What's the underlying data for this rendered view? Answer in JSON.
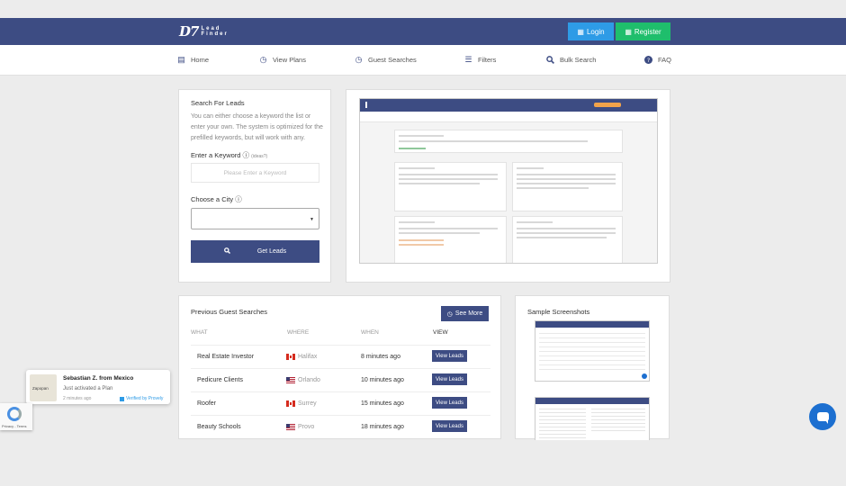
{
  "brand": {
    "mark": "D7",
    "line1": "Lead",
    "line2": "Finder"
  },
  "header": {
    "login_label": "Login",
    "register_label": "Register"
  },
  "nav": [
    {
      "label": "Home",
      "icon": "bank-icon"
    },
    {
      "label": "View Plans",
      "icon": "history-icon"
    },
    {
      "label": "Guest Searches",
      "icon": "history-icon"
    },
    {
      "label": "Filters",
      "icon": "database-icon"
    },
    {
      "label": "Bulk Search",
      "icon": "search-icon"
    },
    {
      "label": "FAQ",
      "icon": "question-icon"
    }
  ],
  "search": {
    "title": "Search For Leads",
    "description": "You can either choose a keyword the list or enter your own. The system is optimized for the prefilled keywords, but will work with any.",
    "keyword_label": "Enter a Keyword",
    "keyword_hint": "(ideas?)",
    "keyword_placeholder": "Please Enter a Keyword",
    "city_label": "Choose a City",
    "city_value": "",
    "button_label": "Get Leads"
  },
  "previous": {
    "title": "Previous Guest Searches",
    "see_more_label": "See More",
    "columns": [
      "WHAT",
      "WHERE",
      "WHEN",
      "VIEW"
    ],
    "rows": [
      {
        "what": "Real Estate Investor",
        "where": "Halifax",
        "flag": "ca",
        "when": "8 minutes ago",
        "view": "View Leads"
      },
      {
        "what": "Pedicure Clients",
        "where": "Orlando",
        "flag": "us",
        "when": "10 minutes ago",
        "view": "View Leads"
      },
      {
        "what": "Roofer",
        "where": "Surrey",
        "flag": "ca",
        "when": "15 minutes ago",
        "view": "View Leads"
      },
      {
        "what": "Beauty Schools",
        "where": "Provo",
        "flag": "us",
        "when": "18 minutes ago",
        "view": "View Leads"
      }
    ]
  },
  "samples": {
    "title": "Sample Screenshots"
  },
  "toast": {
    "name": "Sebastian Z. from Mexico",
    "action": "Just activated a Plan",
    "time": "2 minutes ago",
    "verified": "Verified by Provely",
    "map_label": "Zapopan"
  },
  "recaptcha": {
    "terms": "Privacy - Terms"
  },
  "colors": {
    "primary": "#3d4c83",
    "login": "#2e9be6",
    "register": "#1fbe6c",
    "chat": "#1c6fd0"
  }
}
